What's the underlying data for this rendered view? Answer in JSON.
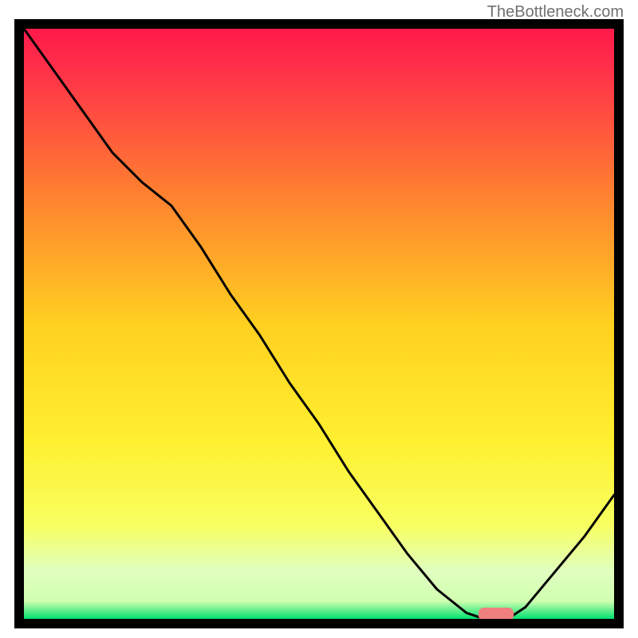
{
  "watermark": "TheBottleneck.com",
  "chart_data": {
    "type": "line",
    "title": "",
    "xlabel": "",
    "ylabel": "",
    "xlim": [
      0,
      100
    ],
    "ylim": [
      0,
      100
    ],
    "grid": false,
    "background_gradient": {
      "top": "#ff1a4a",
      "upper_mid": "#ff8030",
      "mid": "#ffd020",
      "lower_mid": "#f8ff60",
      "near_bottom": "#d0ffb0",
      "bottom": "#00e070"
    },
    "series": [
      {
        "name": "curve",
        "color": "#000000",
        "x": [
          0,
          5,
          10,
          15,
          20,
          25,
          30,
          35,
          40,
          45,
          50,
          55,
          60,
          65,
          70,
          75,
          78,
          80,
          82,
          85,
          90,
          95,
          100
        ],
        "y": [
          100,
          93,
          86,
          79,
          74,
          70,
          63,
          55,
          48,
          40,
          33,
          25,
          18,
          11,
          5,
          1,
          0,
          0,
          0,
          2,
          8,
          14,
          21
        ]
      }
    ],
    "highlight_segment": {
      "color": "#f08080",
      "x": [
        77,
        83
      ],
      "y": [
        0.8,
        0.8
      ],
      "thickness": 2.2
    }
  }
}
